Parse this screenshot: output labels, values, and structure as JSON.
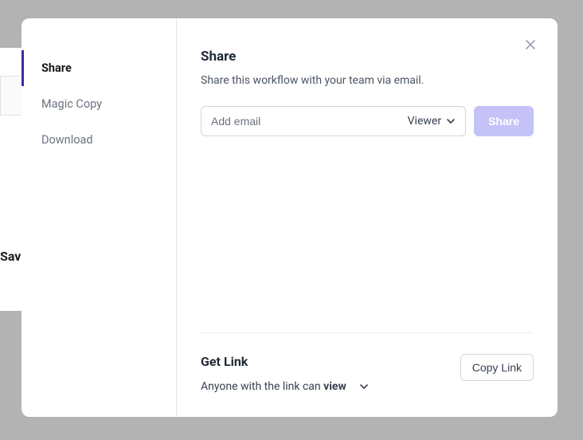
{
  "background": {
    "save_label": "Sav"
  },
  "sidebar": {
    "items": [
      {
        "label": "Share",
        "active": true
      },
      {
        "label": "Magic Copy",
        "active": false
      },
      {
        "label": "Download",
        "active": false
      }
    ]
  },
  "share": {
    "title": "Share",
    "subtitle": "Share this workflow with your team via email.",
    "email_placeholder": "Add email",
    "role_label": "Viewer",
    "share_button": "Share"
  },
  "link": {
    "title": "Get Link",
    "prefix": "Anyone with the link can ",
    "mode": "view",
    "copy_button": "Copy Link"
  }
}
